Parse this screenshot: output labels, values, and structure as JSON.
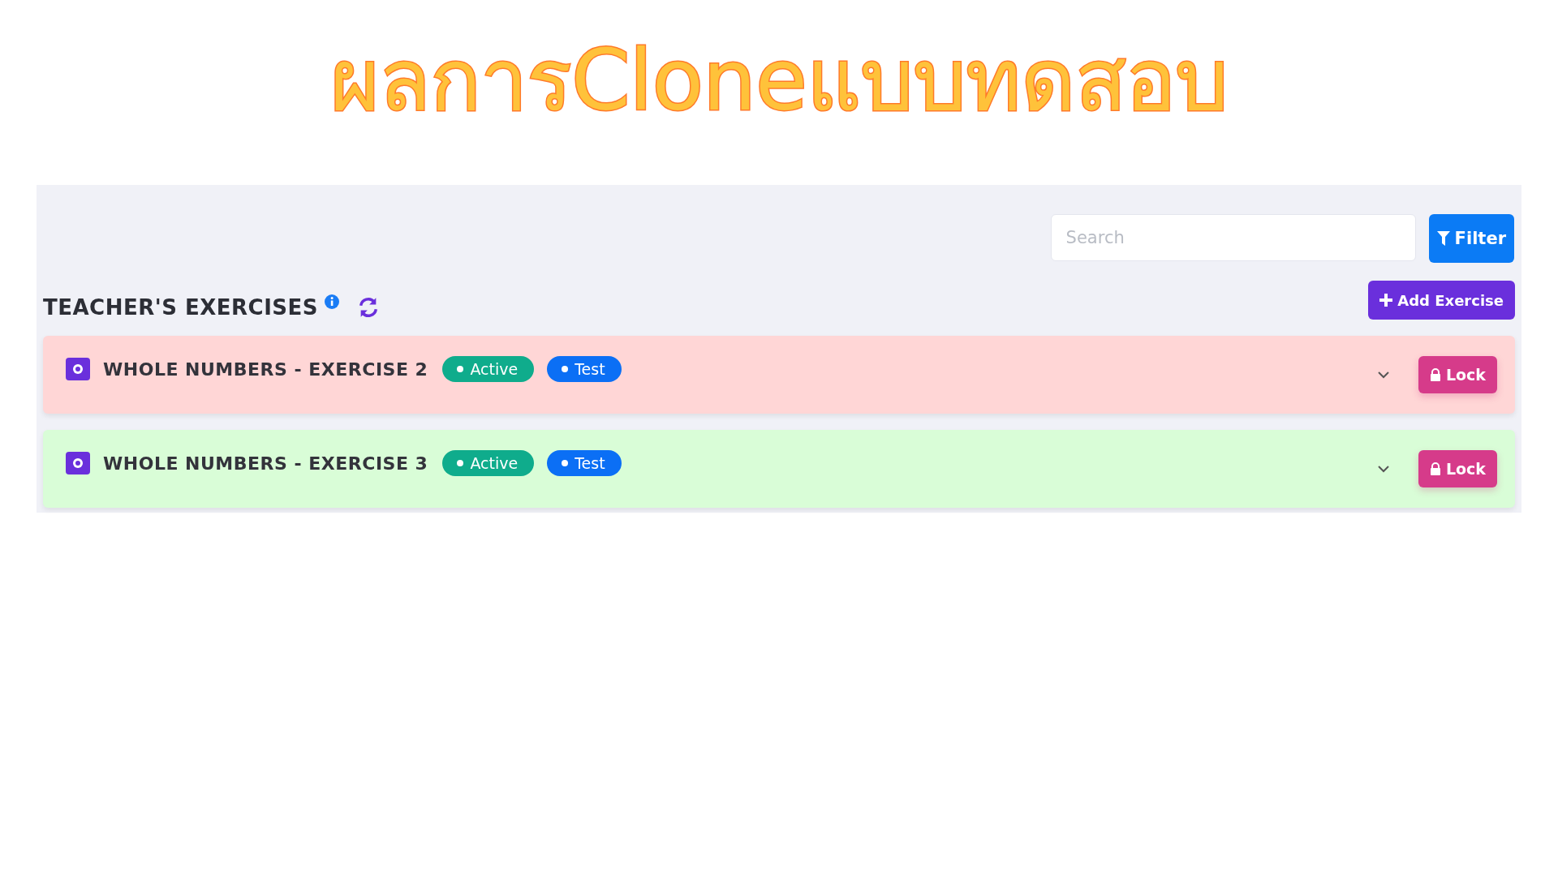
{
  "headline": "ผลการCloneแบบทดสอบ",
  "search": {
    "placeholder": "Search"
  },
  "filter_button": "Filter",
  "section": {
    "title": "TEACHER'S EXERCISES"
  },
  "add_button": "Add Exercise",
  "exercises": [
    {
      "title": "WHOLE NUMBERS - EXERCISE 2",
      "color": "#ffd6d6",
      "tags": [
        {
          "label": "Active",
          "color": "#0fac8c"
        },
        {
          "label": "Test",
          "color": "#0b6ff5"
        }
      ],
      "lock": "Lock"
    },
    {
      "title": "WHOLE NUMBERS - EXERCISE 3",
      "color": "#d9fdd7",
      "tags": [
        {
          "label": "Active",
          "color": "#0fac8c"
        },
        {
          "label": "Test",
          "color": "#0b6ff5"
        }
      ],
      "lock": "Lock"
    }
  ]
}
